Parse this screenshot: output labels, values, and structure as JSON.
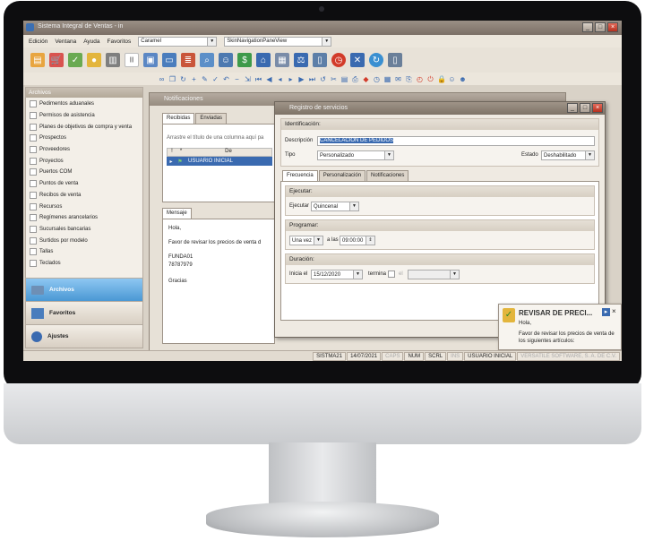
{
  "app": {
    "title": "Sistema Integral de Ventas - in"
  },
  "menu": {
    "items": [
      "Edición",
      "Ventana",
      "Ayuda",
      "Favoritos"
    ],
    "skin_value": "Caramel",
    "skin_view_value": "SkinNavigationPaneView"
  },
  "toolbar": {
    "icons": [
      "open-folder-icon",
      "cart-icon",
      "check-money-icon",
      "coins-icon",
      "cash-register-icon",
      "barcode-icon",
      "id-card-icon",
      "contact-card-icon",
      "books-icon",
      "report-search-icon",
      "users-icon",
      "money-icon",
      "bank-icon",
      "calendar-icon",
      "scales-icon",
      "phone-icon",
      "clock-icon",
      "tools-icon",
      "refresh-icon",
      "mobile-icon"
    ]
  },
  "sidebar": {
    "header": "Archivos",
    "items": [
      "Pedimentos aduanales",
      "Permisos de asistencia",
      "Planes de objetivos de compra y venta",
      "Prospectos",
      "Proveedores",
      "Proyectos",
      "Puertos COM",
      "Puntos de venta",
      "Recibos de venta",
      "Recursos",
      "Regímenes arancelarios",
      "Sucursales bancarias",
      "Surtidos por modelo",
      "Tallas",
      "Teclados"
    ],
    "nav": [
      {
        "label": "Archivos",
        "icon": "folder-icon"
      },
      {
        "label": "Favoritos",
        "icon": "favorites-icon"
      },
      {
        "label": "Ajustes",
        "icon": "settings-icon"
      }
    ]
  },
  "notificaciones": {
    "title": "Notificaciones",
    "tabs": [
      "Recibidas",
      "Enviadas"
    ],
    "group_hint": "Arrastre el título de una columna aquí pa",
    "columns": [
      "!",
      "*",
      "De"
    ],
    "row": {
      "from": "USUARIO INICIAL"
    },
    "message_tab": "Mensaje",
    "message_lines": [
      "Hola,",
      "Favor de revisar los precios de venta d",
      "FUNDA01",
      "78787979",
      "Gracias"
    ]
  },
  "registro": {
    "title": "Registro de servicios",
    "identificacion_label": "Identificación:",
    "descripcion_label": "Descripción",
    "descripcion_value": "CANCELACION DE PEDIDOS",
    "tipo_label": "Tipo",
    "tipo_value": "Personalizado",
    "estado_label": "Estado",
    "estado_value": "Deshabilitado",
    "tabs": [
      "Frecuencia",
      "Personalización",
      "Notificaciones"
    ],
    "ejecutar_group": "Ejecutar:",
    "ejecutar_label": "Ejecutar",
    "ejecutar_value": "Quincenal",
    "programar_group": "Programar:",
    "programar_value": "Una vez",
    "a_las_label": "a las",
    "hora_value": "09:00:00",
    "duracion_group": "Duración:",
    "inicia_label": "Inicia el",
    "inicia_value": "15/12/2020",
    "termina_label": "termina",
    "el_label": "el"
  },
  "status": {
    "segments": [
      "SISTMA21",
      "14/07/2021",
      "CAPS",
      "NUM",
      "SCRL",
      "INS",
      "USUARIO INICIAL",
      "VERSATILE SOFTWARE, S. A. DE C.V."
    ]
  },
  "toast": {
    "title": "REVISAR DE PRECI...",
    "line1": "Hola,",
    "line2": "Favor de revisar los precios de venta de",
    "line3": "los siguientes artículos:"
  }
}
